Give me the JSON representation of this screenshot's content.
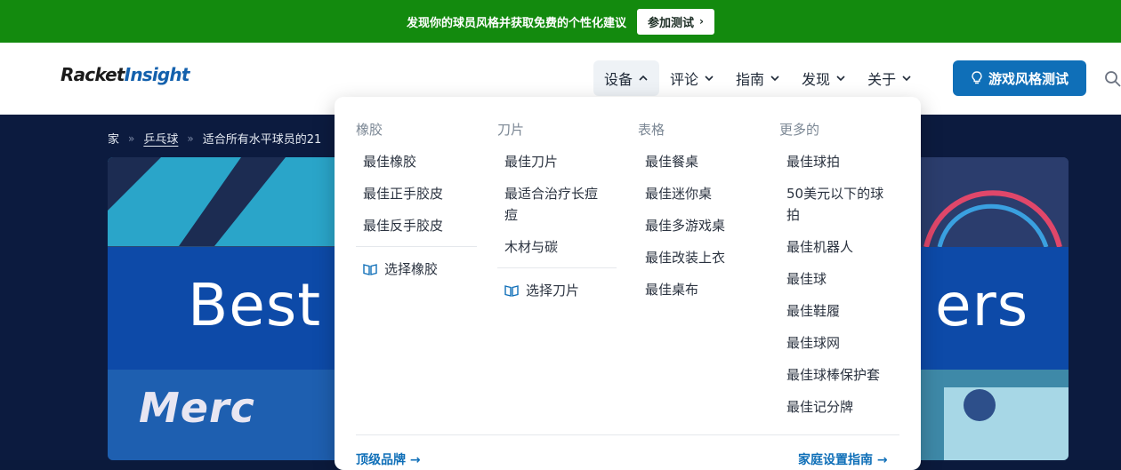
{
  "promo": {
    "text": "发现你的球员风格并获取免费的个性化建议",
    "button_label": "参加测试"
  },
  "logo": {
    "part1": "Racket",
    "part2": "Insight"
  },
  "nav": {
    "items": [
      {
        "label": "设备",
        "active": true
      },
      {
        "label": "评论",
        "active": false
      },
      {
        "label": "指南",
        "active": false
      },
      {
        "label": "发现",
        "active": false
      },
      {
        "label": "关于",
        "active": false
      }
    ],
    "cta_label": "游戏风格测试",
    "cta_icon": "lightbulb-icon",
    "search_icon": "search-icon"
  },
  "breadcrumb": {
    "home": "家",
    "category": "乒乓球",
    "current": "适合所有水平球员的21"
  },
  "hero": {
    "title_left": "Best",
    "title_right": "ers",
    "image_text": "Merc"
  },
  "menu": {
    "col1": {
      "heading": "橡胶",
      "links": [
        "最佳橡胶",
        "最佳正手胶皮",
        "最佳反手胶皮"
      ],
      "guide": "选择橡胶"
    },
    "col2": {
      "heading": "刀片",
      "links": [
        "最佳刀片",
        "最适合治疗长痘痘",
        "木材与碳"
      ],
      "guide": "选择刀片"
    },
    "col3": {
      "heading": "表格",
      "links": [
        "最佳餐桌",
        "最佳迷你桌",
        "最佳多游戏桌",
        "最佳改装上衣",
        "最佳桌布"
      ]
    },
    "col4": {
      "heading": "更多的",
      "links": [
        "最佳球拍",
        "50美元以下的球拍",
        "最佳机器人",
        "最佳球",
        "最佳鞋履",
        "最佳球网",
        "最佳球棒保护套",
        "最佳记分牌"
      ]
    },
    "footer_left": "顶级品牌 →",
    "footer_right": "家庭设置指南 →"
  },
  "colors": {
    "promo_bg": "#138a0e",
    "brand_blue": "#0f6fb8",
    "hero_bg": "#0c1b3f"
  }
}
